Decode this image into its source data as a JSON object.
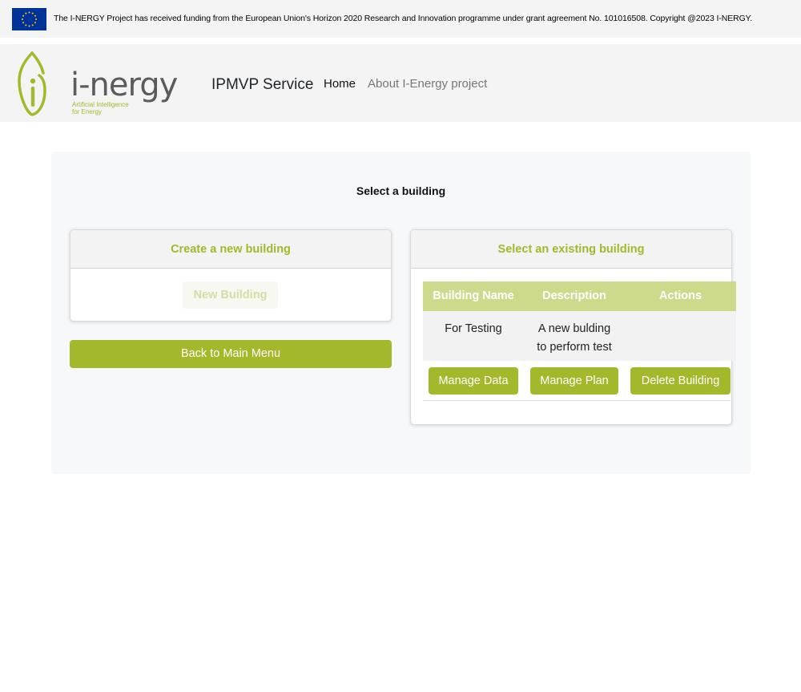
{
  "eu_bar": {
    "funding_text": "The I-NERGY Project has received funding from the European Union's Horizon 2020 Research and Innovation programme under grant agreement No. 101016508. Copyright @2023 I-NERGY."
  },
  "navbar": {
    "logo": {
      "wordmark": "i-nergy",
      "tagline_1": "Artificial Intelligence",
      "tagline_2": "for Energy"
    },
    "brand": "IPMVP Service",
    "links": [
      {
        "label": "Home"
      },
      {
        "label": "About I-Energy project"
      }
    ]
  },
  "main": {
    "title": "Select a building",
    "create_card": {
      "header": "Create a new building",
      "button": "New Building"
    },
    "back_button": "Back to Main Menu",
    "existing_card": {
      "header": "Select an existing building",
      "table": {
        "columns": [
          "Building Name",
          "Description",
          "Actions"
        ],
        "rows": [
          {
            "name": "For Testing",
            "description_line1": "A new bulding",
            "description_line2": "to perform test"
          }
        ]
      },
      "actions": [
        "Manage Data",
        "Manage Plan",
        "Delete Building"
      ]
    }
  },
  "colors": {
    "accent": "#a3b82a",
    "table_header": "#cdd98b",
    "eu_blue": "#003399",
    "eu_star": "#ffcc00"
  }
}
